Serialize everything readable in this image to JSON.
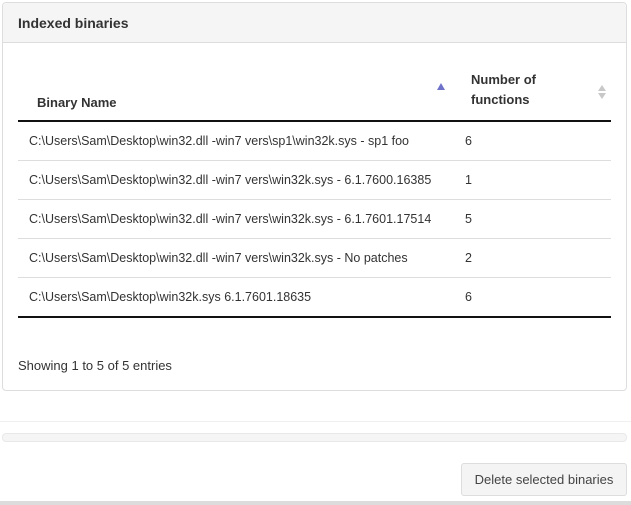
{
  "panel": {
    "title": "Indexed binaries"
  },
  "table": {
    "columns": {
      "name": "Binary Name",
      "count": "Number of functions"
    },
    "rows": [
      {
        "name": "C:\\Users\\Sam\\Desktop\\win32.dll -win7 vers\\sp1\\win32k.sys - sp1 foo",
        "count": "6"
      },
      {
        "name": "C:\\Users\\Sam\\Desktop\\win32.dll -win7 vers\\win32k.sys - 6.1.7600.16385",
        "count": "1"
      },
      {
        "name": "C:\\Users\\Sam\\Desktop\\win32.dll -win7 vers\\win32k.sys - 6.1.7601.17514",
        "count": "5"
      },
      {
        "name": "C:\\Users\\Sam\\Desktop\\win32.dll -win7 vers\\win32k.sys - No patches",
        "count": "2"
      },
      {
        "name": "C:\\Users\\Sam\\Desktop\\win32k.sys 6.1.7601.18635",
        "count": "6"
      }
    ],
    "info": "Showing 1 to 5 of 5 entries"
  },
  "actions": {
    "delete_label": "Delete selected binaries"
  }
}
